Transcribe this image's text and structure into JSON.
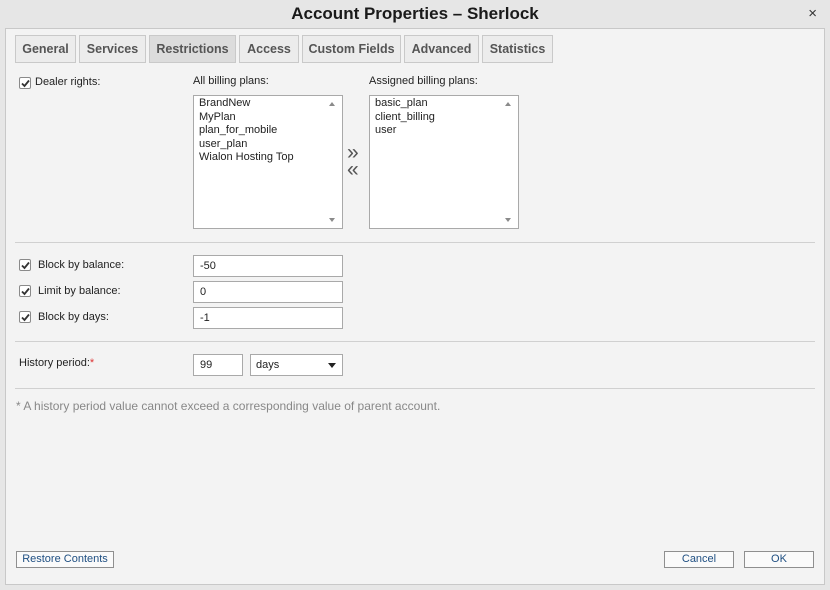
{
  "window": {
    "title": "Account Properties – Sherlock",
    "close_glyph": "×"
  },
  "tabs": [
    {
      "label": "General"
    },
    {
      "label": "Services"
    },
    {
      "label": "Restrictions",
      "active": true
    },
    {
      "label": "Access"
    },
    {
      "label": "Custom Fields"
    },
    {
      "label": "Advanced"
    },
    {
      "label": "Statistics"
    }
  ],
  "dealer": {
    "label": "Dealer rights:",
    "checked": true
  },
  "billing": {
    "all_label": "All billing plans:",
    "all_plans": [
      "BrandNew",
      "MyPlan",
      "plan_for_mobile",
      "user_plan",
      "Wialon Hosting Top"
    ],
    "assigned_label": "Assigned billing plans:",
    "assigned_plans": [
      "basic_plan",
      "client_billing",
      "user"
    ],
    "move_right_glyph": "»",
    "move_left_glyph": "«"
  },
  "balance": {
    "block_label": "Block by balance:",
    "block_value": "-50",
    "limit_label": "Limit by balance:",
    "limit_value": "0",
    "days_label": "Block by days:",
    "days_value": "-1"
  },
  "history": {
    "label": "History period:",
    "required_mark": "*",
    "value": "99",
    "unit": "days"
  },
  "note": "* A history period value cannot exceed a corresponding value of parent account.",
  "footer": {
    "restore_label": "Restore Contents",
    "cancel_label": "Cancel",
    "ok_label": "OK"
  },
  "icons": {
    "checkbox": "check-icon",
    "scroll_up": "scroll-up-icon",
    "scroll_down": "scroll-down-icon",
    "dropdown": "chevron-down-icon"
  }
}
